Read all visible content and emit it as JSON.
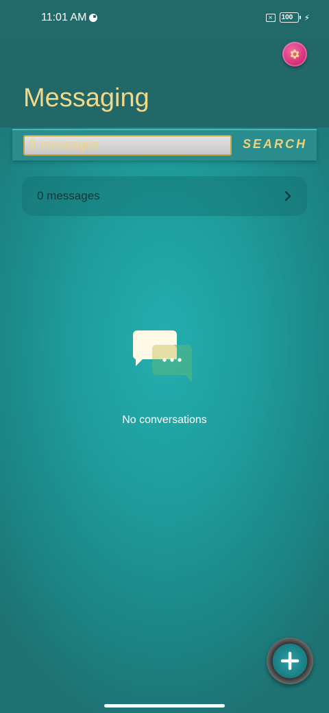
{
  "status_bar": {
    "time": "11:01 AM",
    "battery": "100",
    "icons": [
      "notification-circle-icon",
      "sim-blocked-icon",
      "battery-icon",
      "charging-bolt-icon"
    ]
  },
  "header": {
    "title": "Messaging",
    "settings_icon": "gear-icon"
  },
  "search": {
    "placeholder": "0 messages",
    "value": "",
    "button_label": "SEARCH"
  },
  "messages_row": {
    "label": "0 messages",
    "icon": "chevron-right-icon"
  },
  "empty_state": {
    "label": "No conversations",
    "icon": "chat-bubbles-icon"
  },
  "fab": {
    "icon": "plus-icon"
  },
  "colors": {
    "title": "#f2d98a",
    "search_label": "#ecd27c",
    "settings_button": "#d8327c",
    "background": "#1f9c9c",
    "header": "#236868"
  }
}
